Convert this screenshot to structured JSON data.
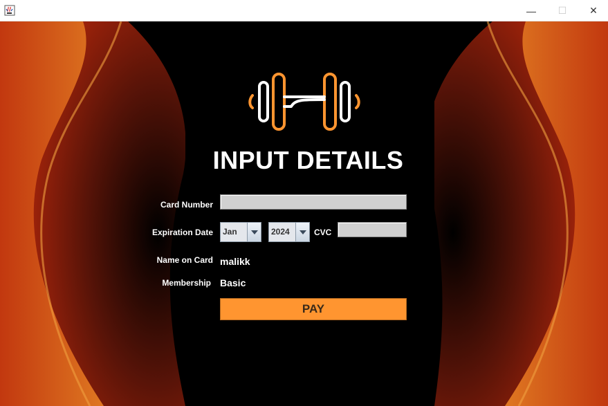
{
  "window": {
    "icon": "java-cup-icon",
    "minimize_glyph": "—",
    "maximize_glyph": "☐",
    "close_glyph": "✕"
  },
  "colors": {
    "accent": "#ff9530",
    "background": "#000000",
    "field": "#d0d0d0"
  },
  "logo_icon": "dumbbell-icon",
  "heading": "INPUT DETAILS",
  "form": {
    "card_number_label": "Card Number",
    "card_number_value": "",
    "expiration_label": "Expiration Date",
    "month_selected": "Jan",
    "year_selected": "2024",
    "cvc_label": "CVC",
    "cvc_value": "",
    "name_label": "Name on Card",
    "name_value": "malikk",
    "membership_label": "Membership",
    "membership_value": "Basic"
  },
  "pay_label": "PAY"
}
